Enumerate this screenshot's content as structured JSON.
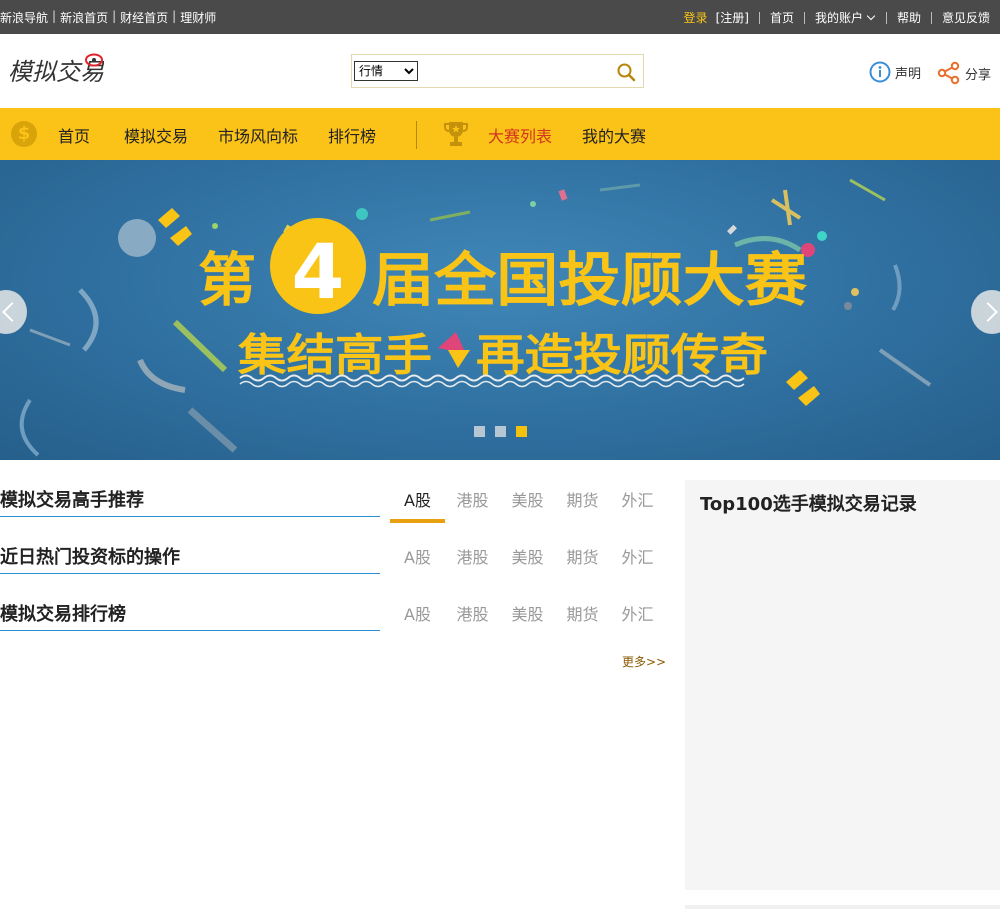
{
  "topbar": {
    "left_links": [
      "新浪导航",
      "新浪首页",
      "财经首页",
      "理财师"
    ],
    "login": "登录",
    "register": "[注册]",
    "home": "首页",
    "account": "我的账户",
    "help": "帮助",
    "feedback": "意见反馈"
  },
  "header": {
    "logo_text": "模拟交易",
    "search_select": "行情",
    "search_options": [
      "行情"
    ],
    "search_value": "",
    "statement": "声明",
    "share": "分享"
  },
  "nav": {
    "items": [
      "首页",
      "模拟交易",
      "市场风向标",
      "排行榜"
    ],
    "contest_items": [
      "大赛列表",
      "我的大赛"
    ],
    "active": "大赛列表"
  },
  "banner": {
    "line1_prefix": "第",
    "number": "4",
    "line1_suffix": "届全国投顾大赛",
    "line2_left": "集结高手",
    "line2_right": "再造投顾传奇",
    "slide_count": 3,
    "active_slide": 3
  },
  "sections": [
    {
      "title": "模拟交易高手推荐",
      "tabs": [
        "A股",
        "港股",
        "美股",
        "期货",
        "外汇"
      ],
      "active_tab": "A股"
    },
    {
      "title": "近日热门投资标的操作",
      "tabs": [
        "A股",
        "港股",
        "美股",
        "期货",
        "外汇"
      ]
    },
    {
      "title": "模拟交易排行榜",
      "tabs": [
        "A股",
        "港股",
        "美股",
        "期货",
        "外汇"
      ]
    }
  ],
  "more_link": "更多>>",
  "sidebar": {
    "title": "Top100选手模拟交易记录"
  },
  "colors": {
    "topbar_bg": "#4a4a4a",
    "nav_bg": "#fbc218",
    "accent_yellow": "#f9c416",
    "active_red": "#d2351e",
    "section_rule": "#2a8fd0",
    "tab_active": "#e8a010"
  }
}
